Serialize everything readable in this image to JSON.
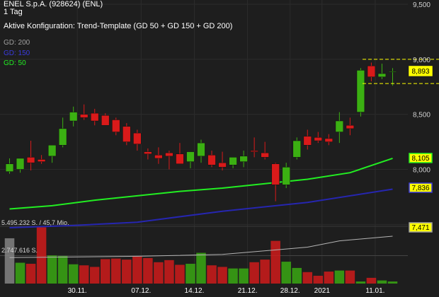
{
  "header": {
    "title": "ENEL S.p.A. (928624) (ENL)",
    "interval": "1 Tag",
    "config": "Aktive Konfiguration: Trend-Template (GD 50 + GD 150 + GD 200)"
  },
  "legend": [
    {
      "label": "GD: 200",
      "color": "#a0a0a0"
    },
    {
      "label": "GD: 150",
      "color": "#3a3adf"
    },
    {
      "label": "GD: 50",
      "color": "#22ee22"
    }
  ],
  "colors": {
    "background": "#1e1e1e",
    "up": "#3bb012",
    "down": "#d91a1a",
    "highlight": "#ffff00",
    "ma200": "#a0a0a0",
    "ma150": "#2626b0",
    "ma50": "#22ee22",
    "vol_avg": "#b4b4b4"
  },
  "volume_labels": [
    "5.495.232 S. / 45,7 Mio.",
    "2.747.616 S."
  ],
  "chart_data": {
    "type": "candlestick",
    "x_tick_labels": [
      "30.11.",
      "07.12.",
      "14.12.",
      "21.12.",
      "28.12.",
      "2021",
      "11.01."
    ],
    "y_ticks": [
      "9,500",
      "9,000",
      "8,500",
      "8,000",
      "7,500"
    ],
    "ylim": [
      7.47,
      9.5
    ],
    "candles": [
      {
        "o": 7.98,
        "h": 8.1,
        "l": 7.96,
        "c": 8.05
      },
      {
        "o": 8.0,
        "h": 8.07,
        "l": 7.97,
        "c": 8.1
      },
      {
        "o": 8.11,
        "h": 8.26,
        "l": 7.99,
        "c": 8.06
      },
      {
        "o": 8.09,
        "h": 8.13,
        "l": 8.05,
        "c": 8.07
      },
      {
        "o": 8.12,
        "h": 8.2,
        "l": 8.06,
        "c": 8.22
      },
      {
        "o": 8.22,
        "h": 8.47,
        "l": 8.2,
        "c": 8.37
      },
      {
        "o": 8.44,
        "h": 8.57,
        "l": 8.39,
        "c": 8.52
      },
      {
        "o": 8.5,
        "h": 8.59,
        "l": 8.45,
        "c": 8.47
      },
      {
        "o": 8.51,
        "h": 8.55,
        "l": 8.4,
        "c": 8.44
      },
      {
        "o": 8.49,
        "h": 8.51,
        "l": 8.42,
        "c": 8.4
      },
      {
        "o": 8.45,
        "h": 8.47,
        "l": 8.31,
        "c": 8.34
      },
      {
        "o": 8.39,
        "h": 8.42,
        "l": 8.22,
        "c": 8.25
      },
      {
        "o": 8.33,
        "h": 8.36,
        "l": 8.17,
        "c": 8.23
      },
      {
        "o": 8.16,
        "h": 8.19,
        "l": 8.09,
        "c": 8.14
      },
      {
        "o": 8.13,
        "h": 8.2,
        "l": 8.05,
        "c": 8.1
      },
      {
        "o": 8.15,
        "h": 8.17,
        "l": 8.0,
        "c": 8.12
      },
      {
        "o": 8.14,
        "h": 8.24,
        "l": 8.06,
        "c": 8.05
      },
      {
        "o": 8.07,
        "h": 8.16,
        "l": 8.01,
        "c": 8.16
      },
      {
        "o": 8.12,
        "h": 8.27,
        "l": 8.06,
        "c": 8.24
      },
      {
        "o": 8.13,
        "h": 8.17,
        "l": 8.02,
        "c": 8.04
      },
      {
        "o": 8.06,
        "h": 8.16,
        "l": 7.99,
        "c": 8.02
      },
      {
        "o": 8.04,
        "h": 8.1,
        "l": 8.01,
        "c": 8.11
      },
      {
        "o": 8.07,
        "h": 8.17,
        "l": 8.02,
        "c": 8.12
      },
      {
        "o": 8.17,
        "h": 8.29,
        "l": 8.11,
        "c": 8.16
      },
      {
        "o": 8.15,
        "h": 8.25,
        "l": 8.09,
        "c": 8.11
      },
      {
        "o": 8.05,
        "h": 8.06,
        "l": 7.71,
        "c": 7.86
      },
      {
        "o": 7.86,
        "h": 8.06,
        "l": 7.83,
        "c": 8.02
      },
      {
        "o": 8.11,
        "h": 8.29,
        "l": 8.09,
        "c": 8.26
      },
      {
        "o": 8.3,
        "h": 8.36,
        "l": 8.18,
        "c": 8.22
      },
      {
        "o": 8.29,
        "h": 8.34,
        "l": 8.24,
        "c": 8.26
      },
      {
        "o": 8.28,
        "h": 8.32,
        "l": 8.22,
        "c": 8.25
      },
      {
        "o": 8.34,
        "h": 8.52,
        "l": 8.24,
        "c": 8.44
      },
      {
        "o": 8.4,
        "h": 8.47,
        "l": 8.31,
        "c": 8.37
      },
      {
        "o": 8.52,
        "h": 8.92,
        "l": 8.48,
        "c": 8.9
      },
      {
        "o": 8.94,
        "h": 8.97,
        "l": 8.8,
        "c": 8.84
      },
      {
        "o": 8.84,
        "h": 8.96,
        "l": 8.82,
        "c": 8.87
      },
      {
        "o": 8.89,
        "h": 8.92,
        "l": 8.76,
        "c": 8.89
      }
    ],
    "ma": [
      {
        "name": "GD: 50",
        "color": "#22ee22",
        "points": [
          [
            0,
            7.64
          ],
          [
            4,
            7.67
          ],
          [
            8,
            7.72
          ],
          [
            12,
            7.76
          ],
          [
            16,
            7.8
          ],
          [
            20,
            7.83
          ],
          [
            24,
            7.87
          ],
          [
            28,
            7.91
          ],
          [
            32,
            7.97
          ],
          [
            36,
            8.1
          ]
        ]
      },
      {
        "name": "GD: 150",
        "color": "#2626b0",
        "points": [
          [
            0,
            7.47
          ],
          [
            6,
            7.49
          ],
          [
            12,
            7.52
          ],
          [
            20,
            7.62
          ],
          [
            28,
            7.7
          ],
          [
            36,
            7.82
          ]
        ]
      }
    ],
    "price_tags": [
      {
        "value": "8,893",
        "y": 8.89,
        "color": "#ffff00"
      },
      {
        "value": "8,105",
        "y": 8.1,
        "color": "#22ee22"
      },
      {
        "value": "7,836",
        "y": 7.83,
        "color": "#3a3adf"
      },
      {
        "value": "7,471",
        "y": 7.47,
        "color": "#a0a0a0"
      }
    ],
    "highlight_range": [
      8.78,
      9.0
    ],
    "volume": [
      4.35,
      2.0,
      1.9,
      5.4,
      2.7,
      2.65,
      1.85,
      1.75,
      1.6,
      2.35,
      2.4,
      2.3,
      2.6,
      2.45,
      2.05,
      2.25,
      1.8,
      1.9,
      2.95,
      1.75,
      1.6,
      1.45,
      1.45,
      2.05,
      2.3,
      4.1,
      2.1,
      1.5,
      1.1,
      0.75,
      1.15,
      1.25,
      1.25,
      0.2,
      0.55,
      0.3,
      0.2
    ],
    "volume_avg": [
      [
        0,
        2.5
      ],
      [
        6,
        2.55
      ],
      [
        12,
        2.62
      ],
      [
        20,
        2.8
      ],
      [
        28,
        3.5
      ],
      [
        31,
        4.1
      ],
      [
        36,
        4.55
      ]
    ],
    "vol_max": 5.5
  }
}
